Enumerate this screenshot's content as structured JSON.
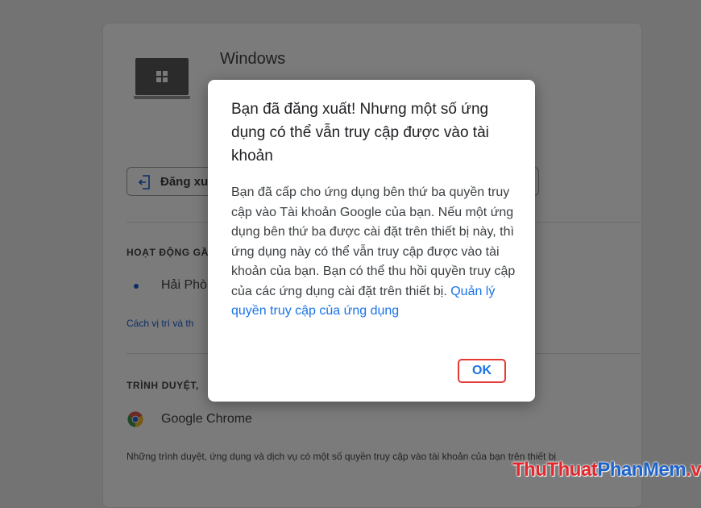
{
  "device": {
    "name": "Windows",
    "signout_label": "Đăng xu"
  },
  "activity": {
    "section_title": "HOẠT ĐỘNG GẦ",
    "location": "Hải Phò",
    "location_link": "Cách vị trí và th"
  },
  "browsers": {
    "section_title": "TRÌNH DUYỆT,",
    "chrome_label": "Google Chrome",
    "footer": "Những trình duyệt, ứng dụng và dịch vụ có một số quyền truy cập vào tài khoản của bạn trên thiết bị"
  },
  "dialog": {
    "title": "Bạn đã đăng xuất! Nhưng một số ứng dụng có thể vẫn truy cập được vào tài khoản",
    "body": "Bạn đã cấp cho ứng dụng bên thứ ba quyền truy cập vào Tài khoản Google của bạn. Nếu một ứng dụng bên thứ ba được cài đặt trên thiết bị này, thì ứng dụng này có thể vẫn truy cập được vào tài khoản của bạn. Bạn có thể thu hồi quyền truy cập của các ứng dụng cài đặt trên thiết bị.",
    "link": "Quản lý quyền truy cập của ứng dụng",
    "ok_label": "OK"
  },
  "watermark": {
    "part1": "ThuThuat",
    "part2": "PhanMem",
    "part3": ".vn"
  },
  "colors": {
    "accent": "#1a73e8",
    "highlight_border": "#e53935"
  }
}
